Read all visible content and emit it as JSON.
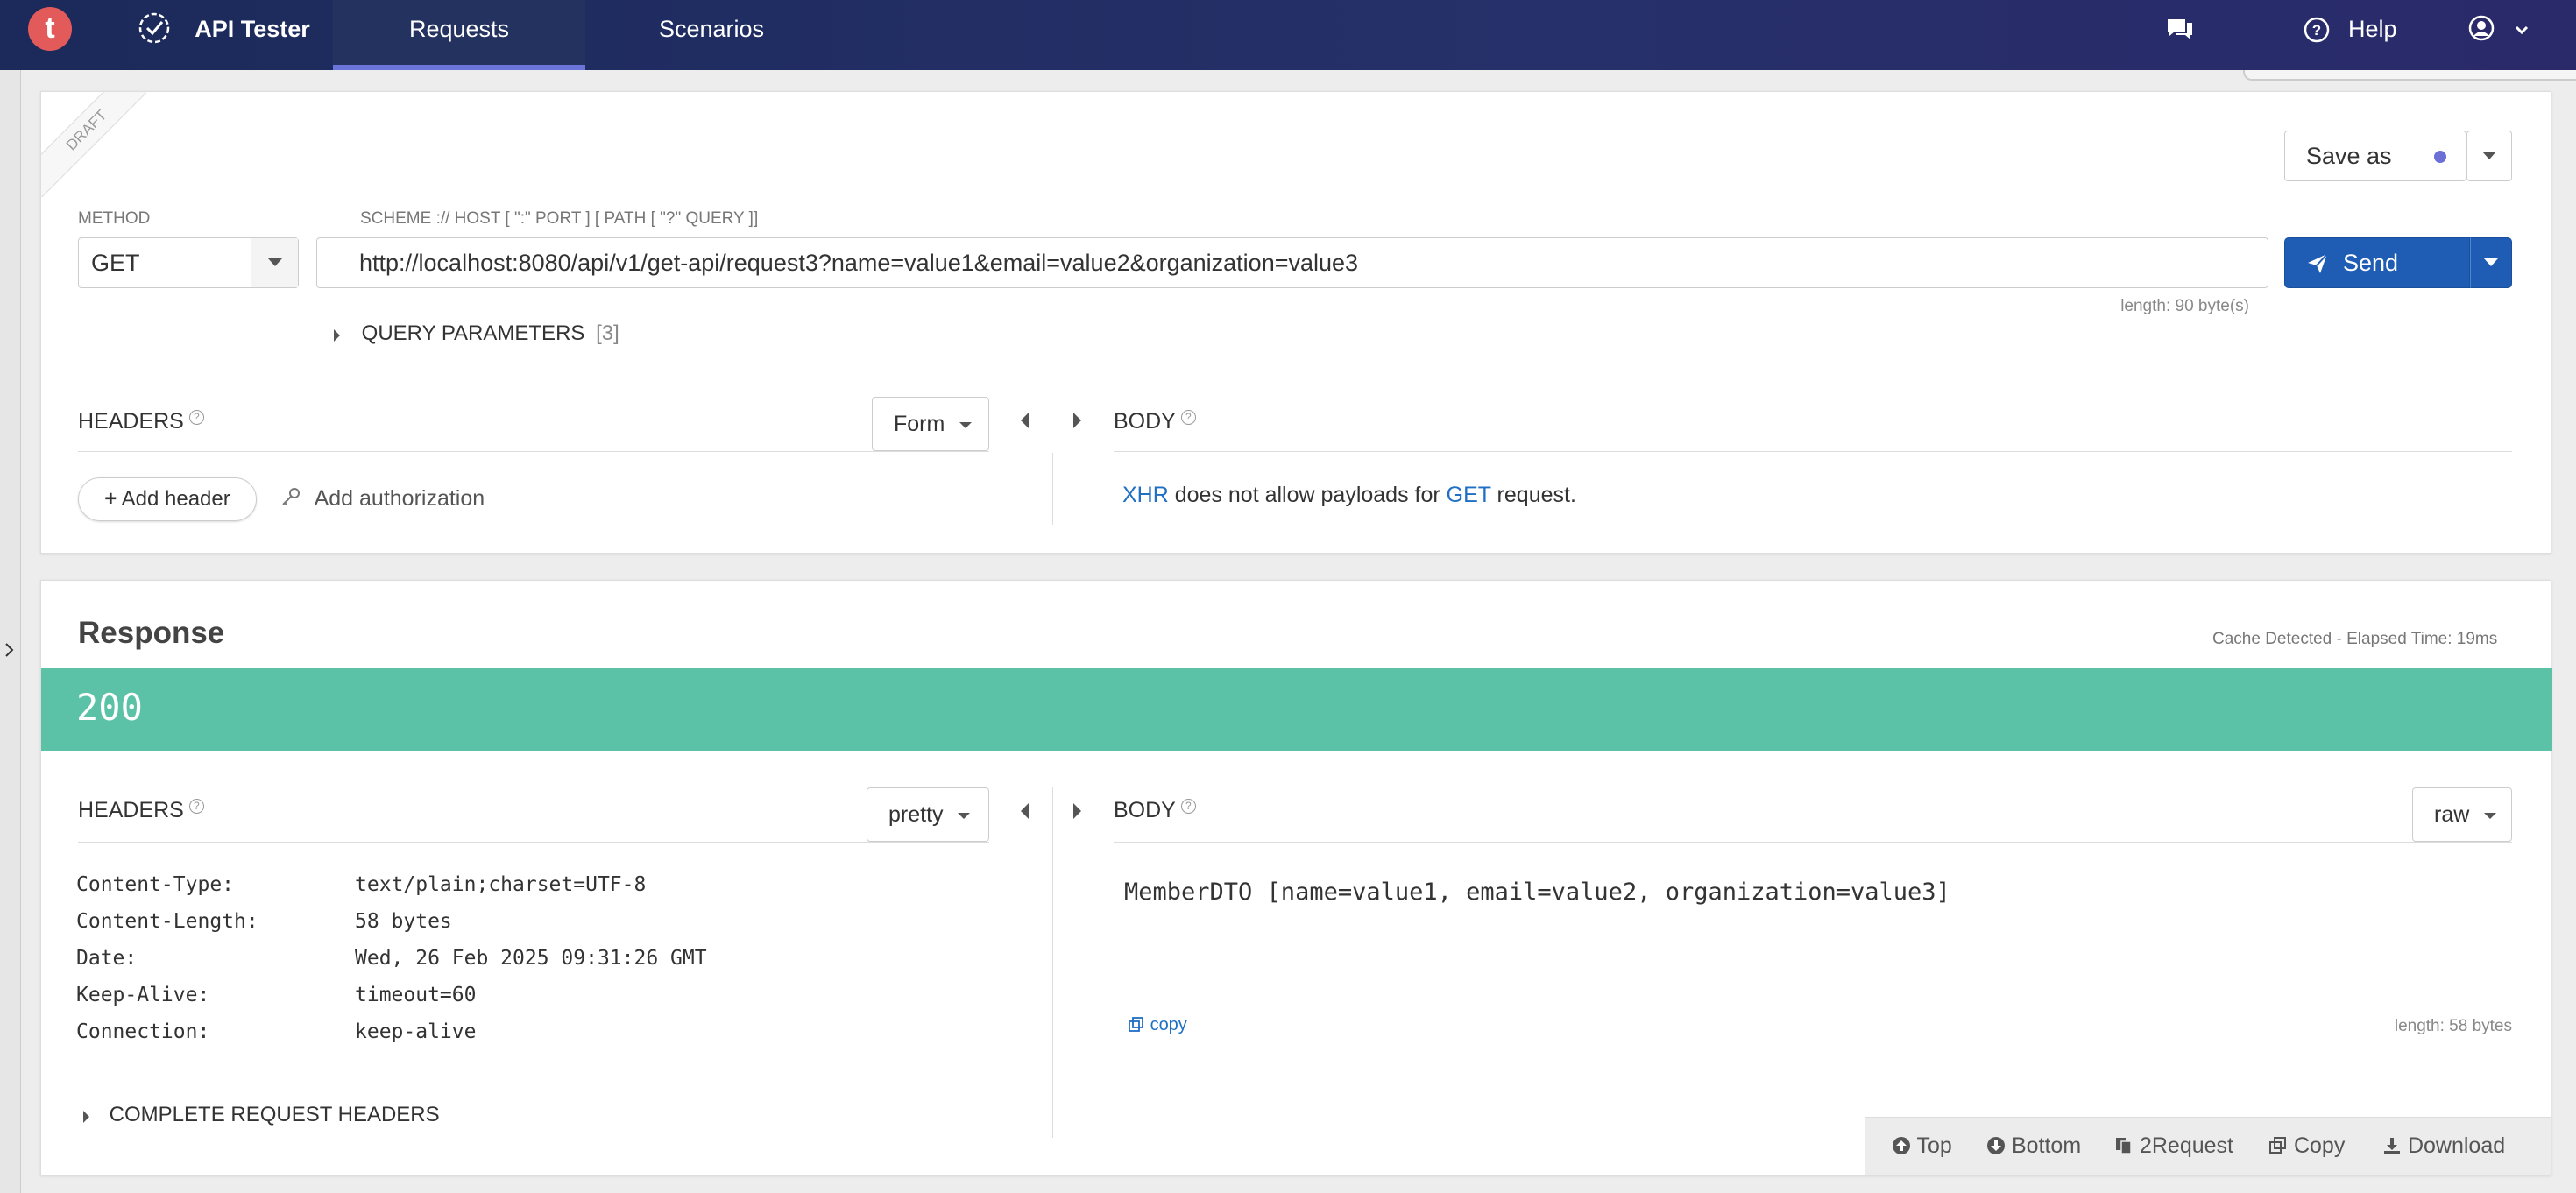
{
  "app": {
    "logo_letter": "t",
    "name": "API Tester"
  },
  "nav": {
    "tabs": [
      {
        "label": "Requests"
      },
      {
        "label": "Scenarios"
      }
    ],
    "help": "Help"
  },
  "request": {
    "draft_label": "DRAFT",
    "save_as_label": "Save as",
    "method_label": "METHOD",
    "method_value": "GET",
    "url_hint": "SCHEME :// HOST [ \":\" PORT ] [ PATH [ \"?\" QUERY ]]",
    "url_value": "http://localhost:8080/api/v1/get-api/request3?name=value1&email=value2&organization=value3",
    "send_label": "Send",
    "length_label": "length: 90 byte(s)",
    "query_params_label": "QUERY PARAMETERS",
    "query_params_count": "[3]",
    "headers_title": "HEADERS",
    "headers_mode": "Form",
    "add_header_label": "Add header",
    "add_auth_label": "Add authorization",
    "body_title": "BODY",
    "body_msg_xhr": "XHR",
    "body_msg_mid": " does not allow payloads for ",
    "body_msg_get": "GET",
    "body_msg_end": " request."
  },
  "response": {
    "title": "Response",
    "meta": "Cache Detected - Elapsed Time: 19ms",
    "status_code": "200",
    "status_color": "#5cc2a7",
    "headers_title": "HEADERS",
    "headers_mode": "pretty",
    "headers": [
      {
        "key": "Content-Type:",
        "value": "text/plain;charset=UTF-8"
      },
      {
        "key": "Content-Length:",
        "value": "58 bytes"
      },
      {
        "key": "Date:",
        "value": "Wed, 26 Feb 2025 09:31:26 GMT"
      },
      {
        "key": "Keep-Alive:",
        "value": "timeout=60"
      },
      {
        "key": "Connection:",
        "value": "keep-alive"
      }
    ],
    "complete_headers_label": "COMPLETE REQUEST HEADERS",
    "body_title": "BODY",
    "body_mode": "raw",
    "body_text": "MemberDTO [name=value1, email=value2, organization=value3]",
    "copy_label": "copy",
    "length_label": "length: 58 bytes"
  },
  "toolbar": {
    "top": "Top",
    "bottom": "Bottom",
    "to_request": "2Request",
    "copy": "Copy",
    "download": "Download"
  }
}
